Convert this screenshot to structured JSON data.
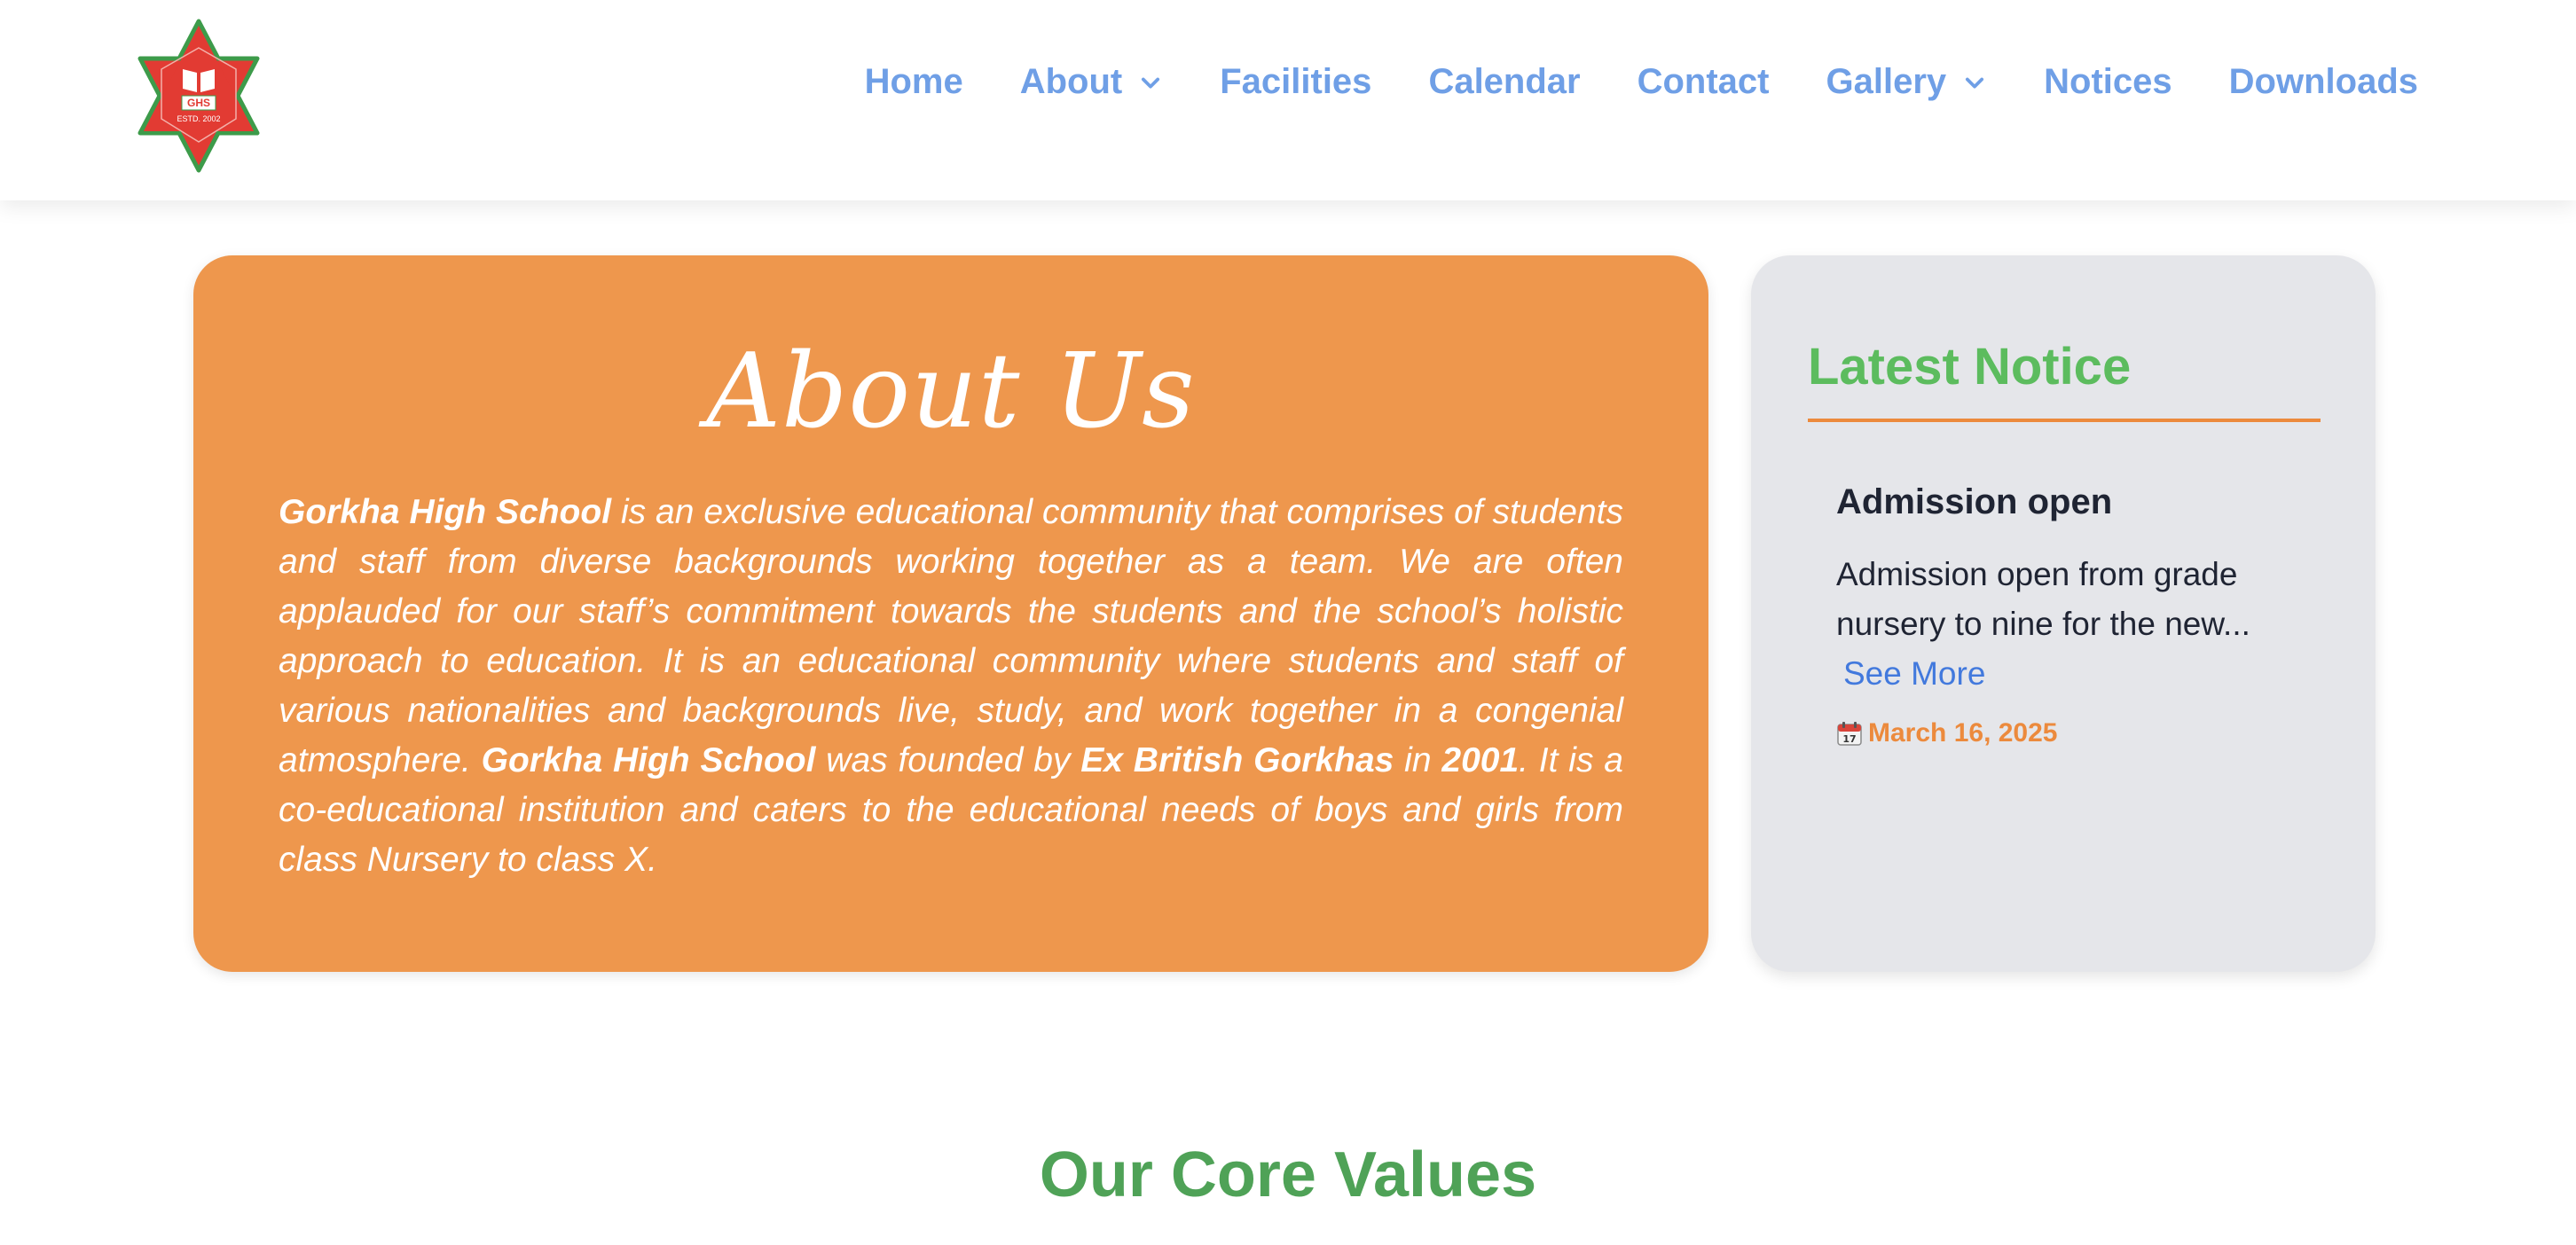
{
  "logo": {
    "initials": "GHS",
    "established": "ESTD. 2002",
    "colors": {
      "star": "#e23b33",
      "border": "#3d9b4a",
      "book": "#ffffff"
    }
  },
  "nav": {
    "items": [
      {
        "label": "Home",
        "has_dropdown": false
      },
      {
        "label": "About",
        "has_dropdown": true
      },
      {
        "label": "Facilities",
        "has_dropdown": false
      },
      {
        "label": "Calendar",
        "has_dropdown": false
      },
      {
        "label": "Contact",
        "has_dropdown": false
      },
      {
        "label": "Gallery",
        "has_dropdown": true
      },
      {
        "label": "Notices",
        "has_dropdown": false
      },
      {
        "label": "Downloads",
        "has_dropdown": false
      }
    ],
    "dropdown_icon": "chevron-down-icon",
    "color": "#6f9fe6"
  },
  "about": {
    "title": "About Us",
    "parts": [
      "Gorkha High School",
      " is an exclusive educational community that comprises of students and staff from diverse backgrounds working together as a team. We are often applauded for our staff’s commitment towards the students and the school’s holistic approach to education. It is an educational community where students and staff of various nationalities and backgrounds live, study, and work together in a congenial atmosphere. ",
      "Gorkha High School",
      " was founded by ",
      "Ex British Gorkhas",
      " in ",
      "2001",
      ". It is a co-educational institution and caters to the educational needs of boys and girls from class Nursery to class X."
    ],
    "background_color": "#ee974d"
  },
  "notice": {
    "heading": "Latest Notice",
    "title": "Admission open",
    "body": "Admission open from grade nursery to nine for the new...",
    "see_more": "See More",
    "date_icon": "calendar-icon",
    "date": "March 16, 2025",
    "colors": {
      "heading": "#5cbc5e",
      "rule": "#ec8a3d",
      "link": "#4279dd",
      "date": "#ec8a3d"
    }
  },
  "core_values": {
    "title": "Our Core Values",
    "color": "#4fa257"
  }
}
